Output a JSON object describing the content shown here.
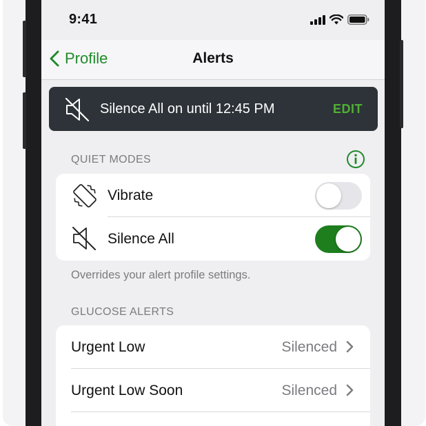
{
  "status_bar": {
    "time": "9:41"
  },
  "nav": {
    "back_label": "Profile",
    "title": "Alerts"
  },
  "banner": {
    "text": "Silence All on until 12:45 PM",
    "action": "EDIT"
  },
  "quiet_modes": {
    "header": "QUIET MODES",
    "items": [
      {
        "label": "Vibrate",
        "icon": "vibrate-icon",
        "enabled": false
      },
      {
        "label": "Silence All",
        "icon": "speaker-muted-icon",
        "enabled": true
      }
    ],
    "footnote": "Overrides your alert profile settings."
  },
  "glucose_alerts": {
    "header": "GLUCOSE ALERTS",
    "items": [
      {
        "label": "Urgent Low",
        "value": "Silenced"
      },
      {
        "label": "Urgent Low Soon",
        "value": "Silenced"
      }
    ]
  },
  "colors": {
    "accent_green": "#1f8a2a",
    "banner_bg": "#2d3338",
    "edit_green": "#4fb034",
    "toggle_on": "#1e7e1e"
  }
}
